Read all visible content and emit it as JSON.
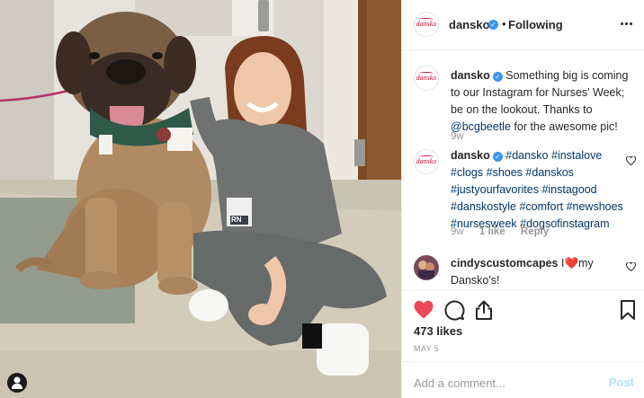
{
  "post": {
    "account": "dansko",
    "verified_badge": "✓",
    "following_dot": "•",
    "follow_status": "Following",
    "avatar_logo_text": "dansko",
    "photo_badge": {
      "text": "RN"
    }
  },
  "comments": [
    {
      "user": "dansko",
      "verified": true,
      "text": "Something big is coming to our Instagram for Nurses' Week; be on the lookout. Thanks to",
      "mention": "@bcgbeetle",
      "text_after": "for the awesome pic!",
      "time": "9w"
    },
    {
      "user": "dansko",
      "verified": true,
      "hashtags": [
        "#dansko",
        "#instalove",
        "#clogs",
        "#shoes",
        "#danskos",
        "#justyourfavorites",
        "#instagood",
        "#danskostyle",
        "#comfort",
        "#newshoes",
        "#nursesweek",
        "#dogsofinstagram"
      ],
      "time": "9w",
      "likes": "1 like",
      "reply": "Reply"
    },
    {
      "user": "cindyscustomcapes",
      "text_before": "I",
      "emoji": "❤️",
      "text_after": "my Dansko's!"
    }
  ],
  "actions": {
    "like_icon": "heart-filled-icon",
    "comment_icon": "comment-bubble-icon",
    "share_icon": "share-icon",
    "save_icon": "bookmark-icon",
    "likes_count": "473 likes",
    "date": "MAY 5"
  },
  "add_comment": {
    "placeholder": "Add a comment...",
    "post_label": "Post"
  },
  "colors": {
    "like_red": "#ed4956",
    "verified_blue": "#3897f0",
    "link_navy": "#003569",
    "muted": "#999999",
    "post_disabled": "#b2dffc",
    "scrub_gray": "#6f7270"
  }
}
